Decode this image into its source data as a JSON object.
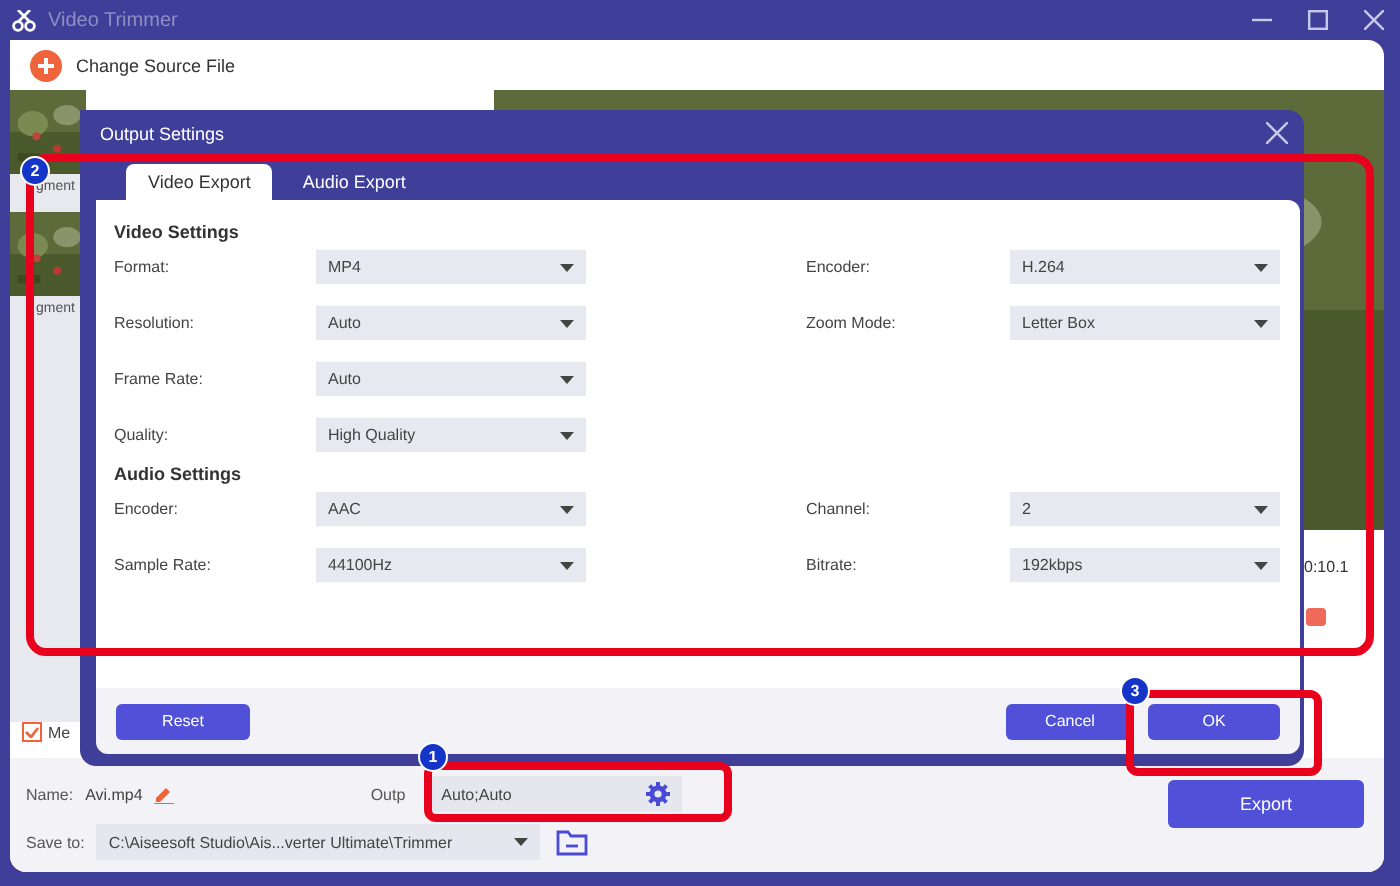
{
  "window": {
    "title": "Video Trimmer"
  },
  "toolbar": {
    "change_source": "Change Source File"
  },
  "segments": [
    {
      "label": "gment"
    },
    {
      "label": "gment"
    }
  ],
  "timeline": {
    "time": "0:10.1"
  },
  "merge_checkbox": {
    "label": "Me",
    "checked": true
  },
  "name_field": {
    "label": "Name:",
    "value": "Avi.mp4"
  },
  "output_field": {
    "label": "Outp",
    "value": "Auto;Auto"
  },
  "save_to": {
    "label": "Save to:",
    "value": "C:\\Aiseesoft Studio\\Ais...verter Ultimate\\Trimmer"
  },
  "export_button": "Export",
  "dialog": {
    "title": "Output Settings",
    "tabs": [
      {
        "label": "Video Export",
        "selected": true
      },
      {
        "label": "Audio Export",
        "selected": false
      }
    ],
    "sections": [
      {
        "heading": "Video Settings",
        "rows": [
          [
            {
              "label": "Format:",
              "value": "MP4"
            },
            {
              "label": "Encoder:",
              "value": "H.264"
            }
          ],
          [
            {
              "label": "Resolution:",
              "value": "Auto"
            },
            {
              "label": "Zoom Mode:",
              "value": "Letter Box"
            }
          ],
          [
            {
              "label": "Frame Rate:",
              "value": "Auto"
            }
          ],
          [
            {
              "label": "Quality:",
              "value": "High Quality"
            }
          ]
        ]
      },
      {
        "heading": "Audio Settings",
        "rows": [
          [
            {
              "label": "Encoder:",
              "value": "AAC"
            },
            {
              "label": "Channel:",
              "value": "2"
            }
          ],
          [
            {
              "label": "Sample Rate:",
              "value": "44100Hz"
            },
            {
              "label": "Bitrate:",
              "value": "192kbps"
            }
          ]
        ]
      }
    ],
    "reset_button": "Reset",
    "cancel_button": "Cancel",
    "ok_button": "OK"
  },
  "annotations": [
    {
      "number": "2"
    },
    {
      "number": "1"
    },
    {
      "number": "3"
    }
  ]
}
